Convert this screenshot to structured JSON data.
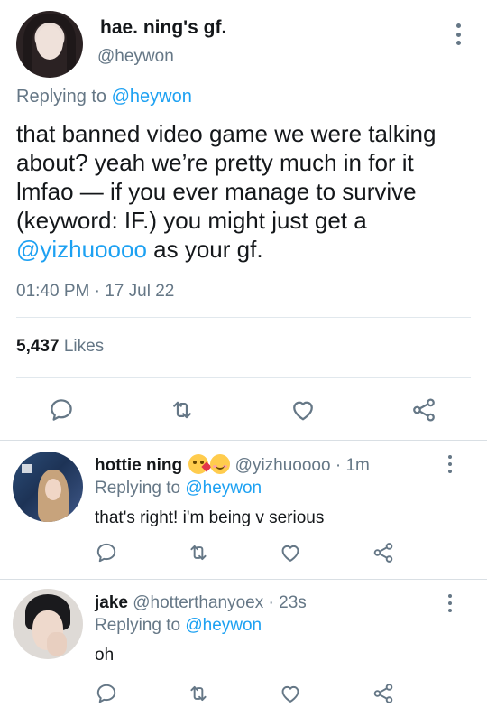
{
  "main_tweet": {
    "display_name": "hae. ning's gf.",
    "handle": "@heywon",
    "replying_prefix": "Replying to",
    "replying_to": "@heywon",
    "text_lines": [
      "that banned video game we were talking",
      "about? yeah we’re pretty much in for it",
      "lmfao — if you ever manage to survive",
      "(keyword: IF.) you might just get a"
    ],
    "text_mention": "@yizhuoooo",
    "text_suffix": " as your gf.",
    "timestamp": "01:40 PM · 17 Jul 22",
    "likes_count": "5,437",
    "likes_label": "Likes"
  },
  "replies": [
    {
      "display_name": "hottie ning",
      "emojis": [
        "kissing-heart-emoji",
        "smiling-blush-emoji"
      ],
      "handle": "@yizhuoooo",
      "time": "· 1m",
      "replying_prefix": "Replying to",
      "replying_to": "@heywon",
      "text": "that's right! i'm being v serious"
    },
    {
      "display_name": "jake",
      "handle": "@hotterthanyoex",
      "time": "· 23s",
      "replying_prefix": "Replying to",
      "replying_to": "@heywon",
      "text": "oh"
    }
  ],
  "icons": [
    "reply-icon",
    "retweet-icon",
    "like-icon",
    "share-icon",
    "more-icon"
  ],
  "colors": {
    "mention": "#1da1f2",
    "secondary_text": "#657786",
    "primary_text": "#14171a",
    "divider": "#e1e8ed"
  }
}
